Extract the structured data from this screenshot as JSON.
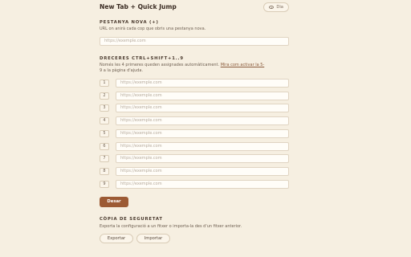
{
  "header": {
    "title": "New Tab + Quick Jump",
    "theme_label": "Dia"
  },
  "new_tab": {
    "heading": "PESTANYA NOVA (+)",
    "description": "URL on anirà cada cop que obris una pestanya nova.",
    "placeholder": "https://exemple.com"
  },
  "shortcuts": {
    "heading": "DRECERES CTRL+SHIFT+1..9",
    "description_pre": "Només les 4 primeres queden assignades automàticament. ",
    "description_link": "Mira com activar la 5-",
    "description_post": "9 a la pàgina d'ajuda.",
    "items": [
      {
        "num": "1",
        "placeholder": "https://exemple.com"
      },
      {
        "num": "2",
        "placeholder": "https://exemple.com"
      },
      {
        "num": "3",
        "placeholder": "https://exemple.com"
      },
      {
        "num": "4",
        "placeholder": "https://exemple.com"
      },
      {
        "num": "5",
        "placeholder": "https://exemple.com"
      },
      {
        "num": "6",
        "placeholder": "https://exemple.com"
      },
      {
        "num": "7",
        "placeholder": "https://exemple.com"
      },
      {
        "num": "8",
        "placeholder": "https://exemple.com"
      },
      {
        "num": "9",
        "placeholder": "https://exemple.com"
      }
    ]
  },
  "save_label": "Desar",
  "backup": {
    "heading": "CÒPIA DE SEGURETAT",
    "description": "Exporta la configuració a un fitxer o importa-la des d'un fitxer anterior.",
    "export_label": "Exportar",
    "import_label": "Importar"
  }
}
